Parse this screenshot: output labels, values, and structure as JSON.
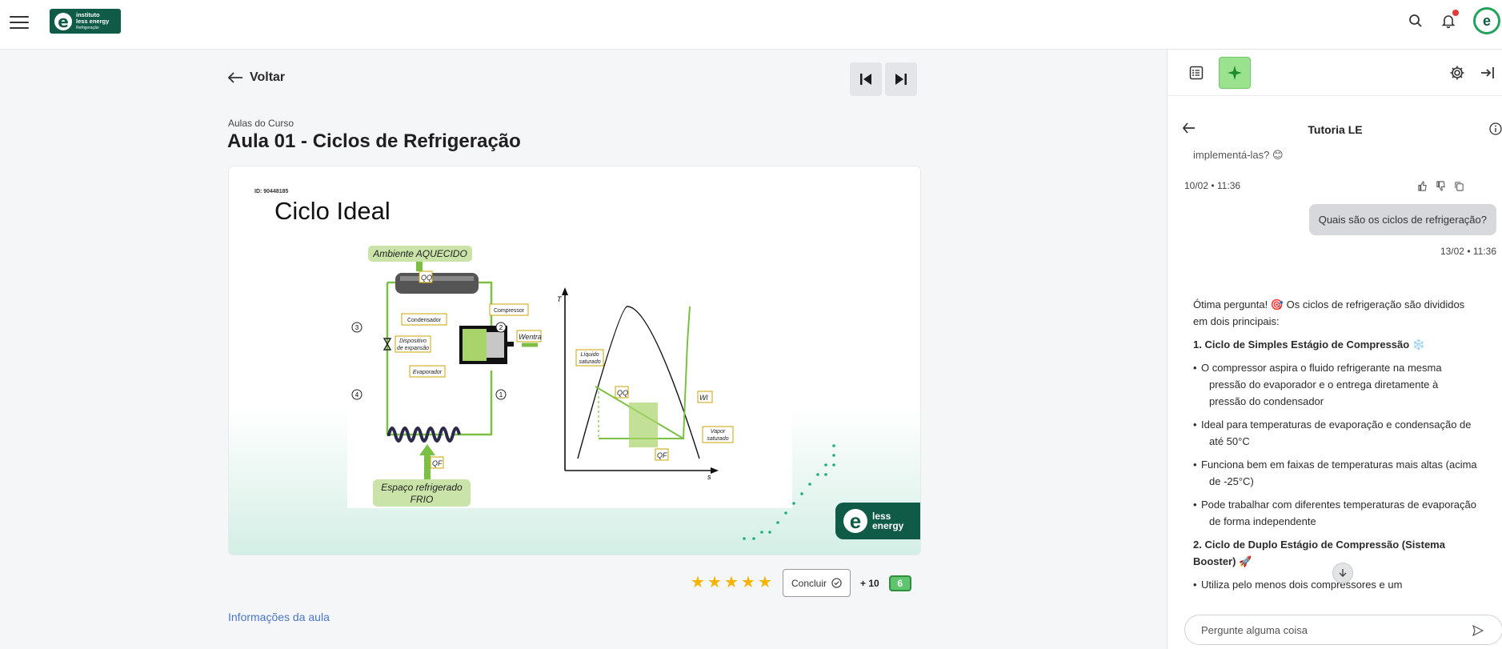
{
  "header": {
    "logo": {
      "line1": "instituto",
      "line2": "less energy",
      "line3": "Refrigeração"
    },
    "icons": [
      "menu-icon",
      "search-icon",
      "bell-icon",
      "avatar"
    ],
    "avatar_initial": "e"
  },
  "main": {
    "back_label": "Voltar",
    "breadcrumb": "Aulas do Curso",
    "title": "Aula 01 - Ciclos de Refrigeração",
    "slide": {
      "id_label": "ID: 90448185",
      "title": "Ciclo Ideal",
      "labels": {
        "ambiente": "Ambiente AQUECIDO",
        "espaco1": "Espaço refrigerado",
        "espaco2": "FRIO",
        "condensador": "Condensador",
        "compressor": "Compressor",
        "dispositivo1": "Dispositivo",
        "dispositivo2": "de expansão",
        "evaporador": "Evaporador",
        "liquido1": "Líquido",
        "liquido2": "saturado",
        "vapor1": "Vapor",
        "vapor2": "saturado",
        "qq": "QQ",
        "qf": "QF",
        "went": "Wentra",
        "wl": "Wl",
        "t_axis": "T",
        "s_axis": "s",
        "n1": "1",
        "n2": "2",
        "n3": "3",
        "n4": "4"
      },
      "brand": {
        "line1": "less",
        "line2": "energy"
      }
    },
    "rating": {
      "stars": 5,
      "max": 5
    },
    "concluir_label": "Concluir",
    "points_label": "+ 10",
    "points_badge": "6",
    "info_link": "Informações da aula"
  },
  "panel": {
    "chat_title": "Tutoria LE",
    "prev_tail": "implementá-las? 😊",
    "prev_meta": "10/02 • 11:36",
    "user_message": "Quais são os ciclos de refrigeração?",
    "user_meta": "13/02 • 11:36",
    "answer": {
      "intro": "Ótima pergunta! 🎯 Os ciclos de refrigeração são divididos em dois principais:",
      "h1": "1. Ciclo de Simples Estágio de Compressão ❄️",
      "items1": [
        "O compressor aspira o fluido refrigerante na mesma pressão do evaporador e o entrega diretamente à pressão do condensador",
        "Ideal para temperaturas de evaporação e condensação de até 50°C",
        "Funciona bem em faixas de temperaturas mais altas (acima de -25°C)",
        "Pode trabalhar com diferentes temperaturas de evaporação de forma independente"
      ],
      "h2": "2. Ciclo de Duplo Estágio de Compressão (Sistema Booster) 🚀",
      "items2": [
        "Utiliza pelo menos dois compressores e um"
      ]
    },
    "input_placeholder": "Pergunte alguma coisa"
  }
}
